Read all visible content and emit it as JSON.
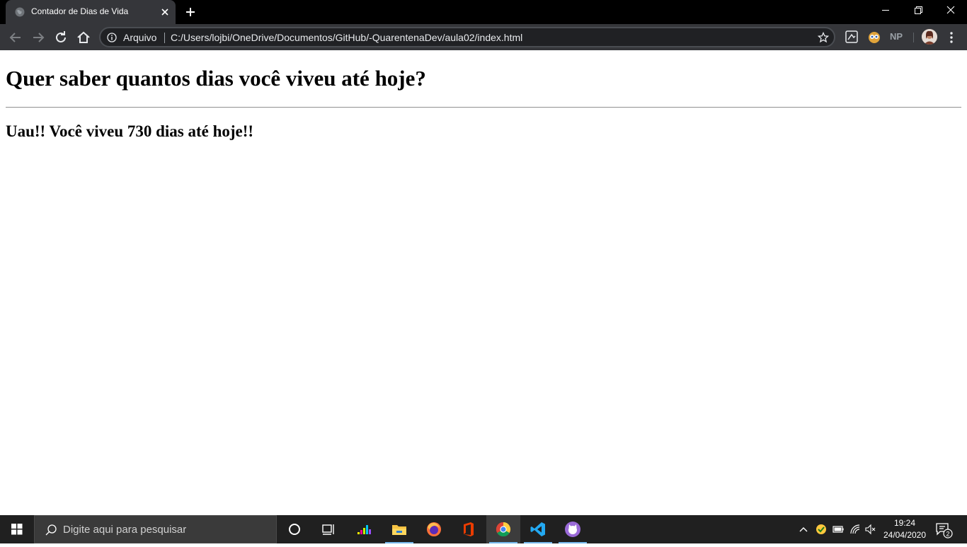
{
  "browser": {
    "tab": {
      "title": "Contador de Dias de Vida"
    },
    "omnibox": {
      "scheme_label": "Arquivo",
      "url": "C:/Users/lojbi/OneDrive/Documentos/GitHub/-QuarentenaDev/aula02/index.html"
    },
    "extensions": [
      {
        "name": "screenshot-extension-icon"
      },
      {
        "name": "owl-extension-icon"
      },
      {
        "name": "np-extension",
        "label": "NP"
      }
    ]
  },
  "page": {
    "heading": "Quer saber quantos dias você viveu até hoje?",
    "result": "Uau!! Você viveu 730 dias até hoje!!"
  },
  "taskbar": {
    "search_placeholder": "Digite aqui para pesquisar",
    "apps": [
      {
        "name": "cortana-icon"
      },
      {
        "name": "task-view-icon"
      },
      {
        "name": "deezer-icon"
      },
      {
        "name": "file-explorer-icon"
      },
      {
        "name": "firefox-icon"
      },
      {
        "name": "office-icon"
      },
      {
        "name": "chrome-icon",
        "active": true
      },
      {
        "name": "vscode-icon"
      },
      {
        "name": "github-desktop-icon"
      }
    ],
    "clock": {
      "time": "19:24",
      "date": "24/04/2020"
    },
    "notification_count": "2"
  },
  "colors": {
    "tabbar_bg": "#000000",
    "toolbar_bg": "#35363a",
    "omnibox_bg": "#202124",
    "taskbar_bg": "#202020",
    "taskbar_accent": "#76b9ed"
  }
}
